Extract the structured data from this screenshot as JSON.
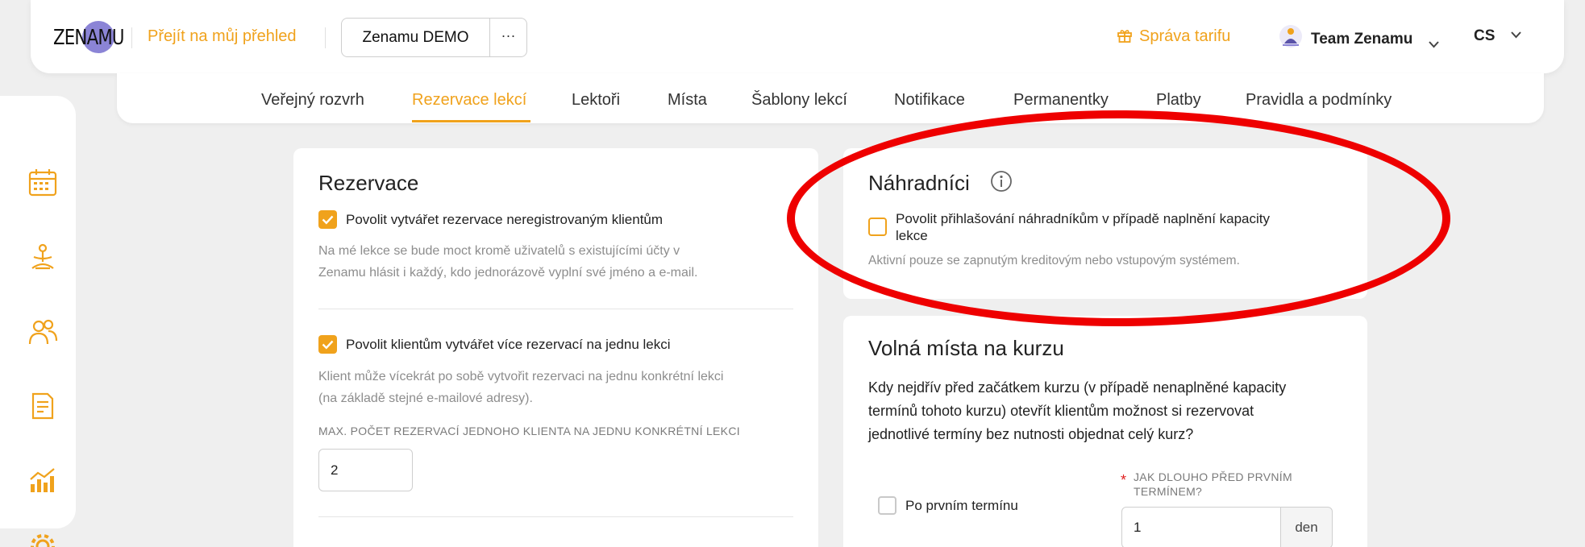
{
  "header": {
    "logo_text": "ZENAMU",
    "overview_link": "Přejít na můj přehled",
    "org_name": "Zenamu DEMO",
    "more_label": "···",
    "tarif_label": "Správa tarifu",
    "team_label": "Team Zenamu",
    "language": "CS"
  },
  "tabs": [
    {
      "label": "Veřejný rozvrh"
    },
    {
      "label": "Rezervace lekcí"
    },
    {
      "label": "Lektoři"
    },
    {
      "label": "Místa"
    },
    {
      "label": "Šablony lekcí"
    },
    {
      "label": "Notifikace"
    },
    {
      "label": "Permanentky"
    },
    {
      "label": "Platby"
    },
    {
      "label": "Pravidla a podmínky"
    }
  ],
  "active_tab": "Rezervace lekcí",
  "sidebar": {
    "icons": [
      "calendar-icon",
      "yoga-icon",
      "people-icon",
      "receipt-icon",
      "chart-icon",
      "gear-icon"
    ]
  },
  "reservations_card": {
    "title": "Rezervace",
    "option1_label": "Povolit vytvářet rezervace neregistrovaným klientům",
    "option1_checked": true,
    "option1_help_line1": "Na mé lekce se bude moct kromě uživatelů s existujícími účty v",
    "option1_help_line2": "Zenamu hlásit i každý, kdo jednorázově vyplní své jméno a e-mail.",
    "option2_label": "Povolit klientům vytvářet více rezervací na jednu lekci",
    "option2_checked": true,
    "option2_help_line1": "Klient může vícekrát po sobě vytvořit rezervaci na jednu konkrétní lekci",
    "option2_help_line2": "(na základě stejné e-mailové adresy).",
    "max_caption": "MAX. POČET REZERVACÍ JEDNOHO KLIENTA NA JEDNU KONKRÉTNÍ LEKCI",
    "max_value": "2"
  },
  "substitutes_card": {
    "title": "Náhradníci",
    "option_label_line1": "Povolit přihlašování náhradníkům v případě naplnění kapacity",
    "option_label_line2": "lekce",
    "option_checked": false,
    "help": "Aktivní pouze se zapnutým kreditovým nebo vstupovým systémem."
  },
  "course_card": {
    "title": "Volná místa na kurzu",
    "question_line1": "Kdy nejdřív před začátkem kurzu (v případě nenaplněné kapacity",
    "question_line2": "termínů tohoto kurzu) otevřít klientům možnost si rezervovat",
    "question_line3": "jednotlivé termíny bez nutnosti objednat celý kurz?",
    "after_first_label": "Po prvním termínu",
    "after_first_checked": false,
    "required_mark": "*",
    "how_long_caption_line1": "JAK DLOUHO PŘED PRVNÍM",
    "how_long_caption_line2": "TERMÍNEM?",
    "how_long_value": "1",
    "unit": "den"
  },
  "colors": {
    "accent": "#f0a21c",
    "annotation": "#ee0000"
  }
}
